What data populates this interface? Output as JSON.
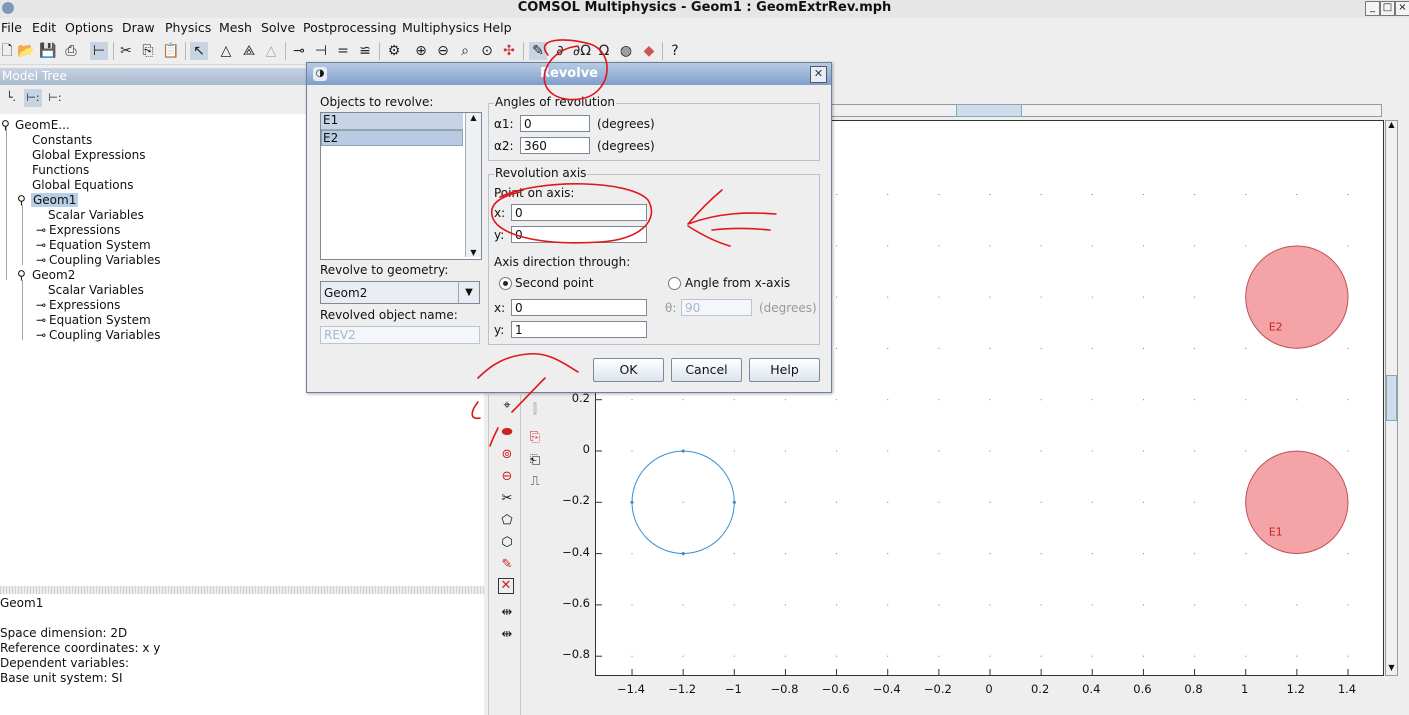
{
  "window": {
    "title": "COMSOL Multiphysics - Geom1 : GeomExtrRev.mph",
    "controls": [
      "_",
      "□",
      "×"
    ]
  },
  "menubar": [
    "File",
    "Edit",
    "Options",
    "Draw",
    "Physics",
    "Mesh",
    "Solve",
    "Postprocessing",
    "Multiphysics",
    "Help"
  ],
  "toolbar_icons": [
    "new-icon",
    "open-icon",
    "save-icon",
    "print-icon",
    "tree-view-icon",
    "cut-icon",
    "copy-icon",
    "paste-icon",
    "select-icon",
    "draw-triangle-icon",
    "draw-mesh-icon",
    "refine-icon",
    "boundary-icon",
    "subdomain-icon",
    "equal-icon",
    "edge-icon",
    "solve-icon",
    "zoom-in-icon",
    "zoom-out-icon",
    "zoom-window-icon",
    "zoom-selected-icon",
    "zoom-extents-icon",
    "draw-mode-icon",
    "point-mode-icon",
    "edge-mode-icon",
    "omega-icon",
    "mesh-mode-icon",
    "post-mode-icon",
    "help-icon"
  ],
  "model_tree": {
    "header": "Model Tree",
    "nodes": [
      {
        "label": "GeomE...",
        "level": 0
      },
      {
        "label": "Constants",
        "level": 1
      },
      {
        "label": "Global Expressions",
        "level": 1
      },
      {
        "label": "Functions",
        "level": 1
      },
      {
        "label": "Global Equations",
        "level": 1
      },
      {
        "label": "Geom1",
        "level": 1,
        "selected": true
      },
      {
        "label": "Scalar Variables",
        "level": 2
      },
      {
        "label": "Expressions",
        "level": 2
      },
      {
        "label": "Equation System",
        "level": 2
      },
      {
        "label": "Coupling Variables",
        "level": 2
      },
      {
        "label": "Geom2",
        "level": 1
      },
      {
        "label": "Scalar Variables",
        "level": 2
      },
      {
        "label": "Expressions",
        "level": 2
      },
      {
        "label": "Equation System",
        "level": 2
      },
      {
        "label": "Coupling Variables",
        "level": 2
      }
    ]
  },
  "properties": {
    "title": "Geom1",
    "lines": [
      "Space dimension: 2D",
      "Reference coordinates: x y",
      "Dependent variables:",
      "Base unit system: SI"
    ]
  },
  "dialog": {
    "title": "Revolve",
    "objects_label": "Objects to revolve:",
    "objects": [
      "E1",
      "E2"
    ],
    "revolve_to_label": "Revolve to geometry:",
    "revolve_to_value": "Geom2",
    "object_name_label": "Revolved object name:",
    "object_name_value": "REV2",
    "angles_group": "Angles of revolution",
    "alpha1_label": "α1:",
    "alpha1_value": "0",
    "alpha2_label": "α2:",
    "alpha2_value": "360",
    "degrees": "(degrees)",
    "axis_group": "Revolution axis",
    "point_label": "Point on axis:",
    "point_x_label": "x:",
    "point_x_value": "0",
    "point_y_label": "y:",
    "point_y_value": "0",
    "direction_label": "Axis direction through:",
    "second_point_label": "Second point",
    "angle_label": "Angle from x-axis",
    "dir_x_label": "x:",
    "dir_x_value": "0",
    "dir_y_label": "y:",
    "dir_y_value": "1",
    "theta_label": "θ:",
    "theta_value": "90",
    "ok": "OK",
    "cancel": "Cancel",
    "help": "Help"
  },
  "plot": {
    "xticks": [
      "−1.4",
      "−1.2",
      "−1",
      "−0.8",
      "−0.6",
      "−0.4",
      "−0.2",
      "0",
      "0.2",
      "0.4",
      "0.6",
      "0.8",
      "1",
      "1.2",
      "1.4"
    ],
    "yticks": [
      "0.2",
      "0",
      "−0.2",
      "−0.4",
      "−0.6",
      "−0.8"
    ],
    "objects": [
      {
        "name": "E2",
        "cx": 1.2,
        "cy": 0.6,
        "r": 0.2,
        "fill": "#f4a3a6"
      },
      {
        "name": "E1",
        "cx": 1.2,
        "cy": -0.2,
        "r": 0.2,
        "fill": "#f4a3a6"
      }
    ],
    "circle_outline": {
      "cx": -1.2,
      "cy": -0.2,
      "r": 0.2,
      "color": "#3a8fd0"
    }
  },
  "annotation_color": "#e0161c"
}
